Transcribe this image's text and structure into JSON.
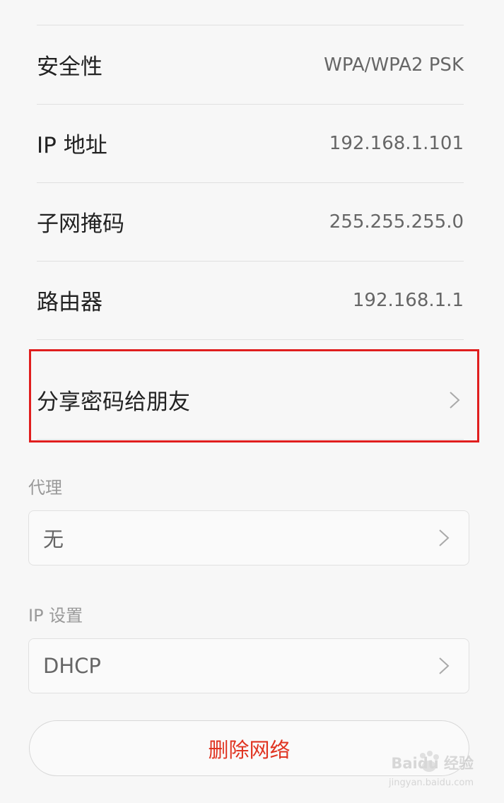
{
  "details": [
    {
      "label": "安全性",
      "value": "WPA/WPA2 PSK"
    },
    {
      "label": "IP 地址",
      "value": "192.168.1.101"
    },
    {
      "label": "子网掩码",
      "value": "255.255.255.0"
    },
    {
      "label": "路由器",
      "value": "192.168.1.1"
    }
  ],
  "share": {
    "label": "分享密码给朋友"
  },
  "proxy": {
    "section_label": "代理",
    "value": "无"
  },
  "ip_settings": {
    "section_label": "IP 设置",
    "value": "DHCP"
  },
  "delete_button": {
    "label": "删除网络"
  },
  "watermark": {
    "brand": "Baidu 经验",
    "url": "jingyan.baidu.com"
  },
  "colors": {
    "highlight": "#e01e1e",
    "danger_text": "#e03421",
    "background": "#f7f7f7"
  }
}
